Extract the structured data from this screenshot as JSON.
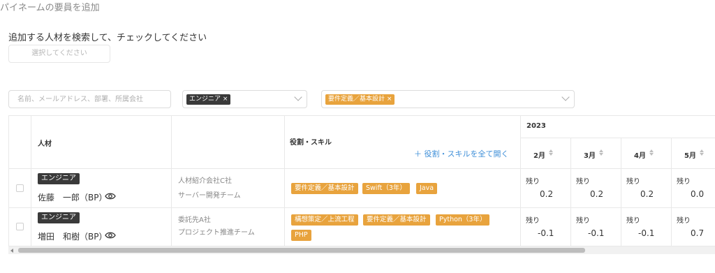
{
  "page_title": "パイネームの要員を追加",
  "instruction": "追加する人材を検索して、チェックしてください",
  "select_button": "選択してください",
  "search": {
    "placeholder": "名前、メールアドレス、部署、所属会社"
  },
  "filters": {
    "role_chip": "エンジニア",
    "skill_chip": "要件定義／基本設計",
    "chip_remove": "×"
  },
  "table": {
    "headers": {
      "person": "人材",
      "skills": "役割・スキル"
    },
    "year": "2023",
    "expand_all": "＋ 役割・スキルを全て開く",
    "months": [
      "2月",
      "3月",
      "4月",
      "5月"
    ],
    "remaining_label": "残り",
    "rows": [
      {
        "role": "エンジニア",
        "name": "佐藤　一郎（BP）",
        "company": "人材紹介会社C社",
        "team": "サーバー開発チーム",
        "skills": [
          "要件定義／基本設計",
          "Swift（3年）",
          "Java"
        ],
        "values": [
          "0.2",
          "0.2",
          "0.2",
          "0.0"
        ]
      },
      {
        "role": "エンジニア",
        "name": "増田　和樹（BP）",
        "company": "委託先A社",
        "team": "プロジェクト推進チーム",
        "skills": [
          "構想策定／上流工程",
          "要件定義／基本設計",
          "Python（3年）",
          "PHP"
        ],
        "values": [
          "-0.1",
          "-0.1",
          "-0.1",
          "0.7"
        ]
      }
    ]
  },
  "colors": {
    "accent": "#e8a33d",
    "badge": "#3a3a3a",
    "link": "#3f8fd8"
  }
}
